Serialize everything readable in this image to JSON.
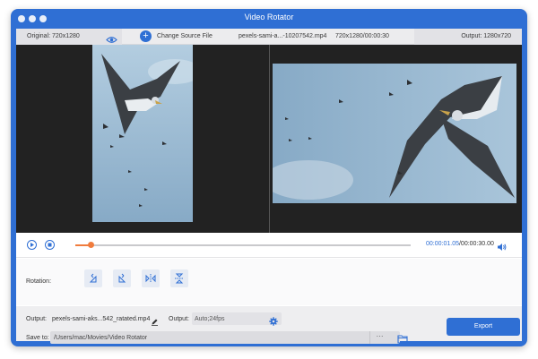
{
  "app": {
    "title": "Video Rotator"
  },
  "infobar": {
    "original": "Original: 720x1280",
    "change_source": "Change Source File",
    "file_name": "pexels-sami-a...-10207542.mp4",
    "file_meta": "720x1280/00:00:30",
    "output": "Output: 1280x720"
  },
  "player": {
    "current_time": "00:00:01.05",
    "total_time": "/00:00:30.00",
    "progress": 0.045
  },
  "rotation": {
    "label": "Rotation:"
  },
  "output_settings": {
    "output_label": "Output:",
    "output_file": "pexels-sami-aks...542_ratated.mp4",
    "format_label": "Output:",
    "format_value": "Auto;24fps",
    "save_label": "Save to:",
    "save_path": "/Users/mac/Movies/Video Rotator",
    "browse_label": "···",
    "export_label": "Export"
  },
  "colors": {
    "accent": "#2f6fd4",
    "progress": "#f07c3e",
    "sky": "#9dbdd6"
  },
  "icons": [
    "eye-icon",
    "add-icon",
    "play-icon",
    "stop-icon",
    "volume-icon",
    "rotate-left-icon",
    "rotate-right-icon",
    "flip-horizontal-icon",
    "flip-vertical-icon",
    "edit-icon",
    "gear-icon",
    "folder-icon"
  ]
}
